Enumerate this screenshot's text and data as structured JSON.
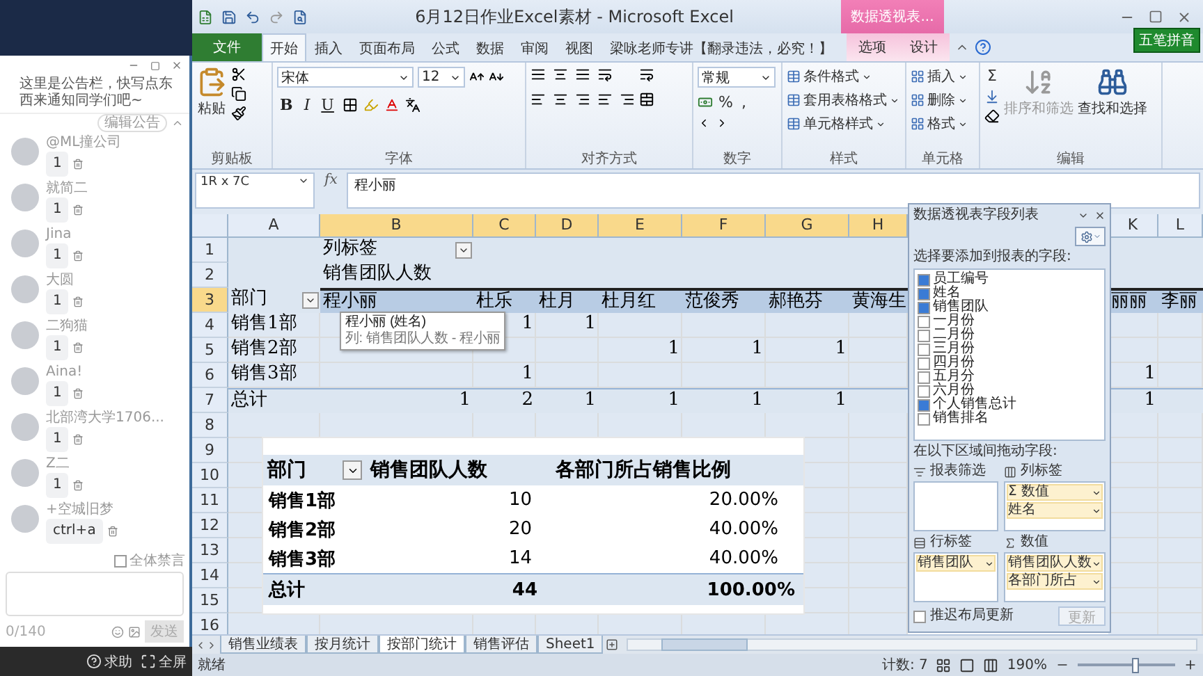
{
  "chat": {
    "announcement": "这里是公告栏，快写点东西来通知同学们吧~",
    "edit_button": "编辑公告",
    "members": [
      {
        "name": "@ML撞公司",
        "message": "1"
      },
      {
        "name": "就简二",
        "message": "1"
      },
      {
        "name": "Jina",
        "message": "1"
      },
      {
        "name": "大圆",
        "message": "1"
      },
      {
        "name": "二狗猫",
        "message": "1"
      },
      {
        "name": "Aina!",
        "message": "1"
      },
      {
        "name": "北部湾大学1706...",
        "message": "1"
      },
      {
        "name": "Z二",
        "message": "1"
      },
      {
        "name": "+空城旧梦",
        "message": "ctrl+a"
      }
    ],
    "mute_all": {
      "label": "全体禁言",
      "checked": false
    },
    "char_count": "0/140",
    "send_button": "发送",
    "help": "求助",
    "fullscreen": "全屏"
  },
  "excel": {
    "title": "6月12日作业Excel素材 - Microsoft Excel",
    "context_group": "数据透视表...",
    "ime_label": "五笔拼音",
    "file_tab": "文件",
    "tabs": [
      {
        "label": "开始",
        "selected": true
      },
      {
        "label": "插入",
        "selected": false
      },
      {
        "label": "页面布局",
        "selected": false
      },
      {
        "label": "公式",
        "selected": false
      },
      {
        "label": "数据",
        "selected": false
      },
      {
        "label": "审阅",
        "selected": false
      },
      {
        "label": "视图",
        "selected": false
      },
      {
        "label": "梁咏老师专讲【翻录违法，必究！】",
        "selected": false
      }
    ],
    "context_tabs": [
      {
        "label": "选项",
        "selected": false
      },
      {
        "label": "设计",
        "selected": false
      }
    ],
    "ribbon": {
      "clipboard": {
        "paste": "粘贴",
        "label": "剪贴板"
      },
      "font": {
        "name": "宋体",
        "size": "12",
        "bold": "B",
        "italic": "I",
        "underline": "U",
        "label": "字体"
      },
      "alignment": {
        "label": "对齐方式"
      },
      "number": {
        "format": "常规",
        "percent": "%",
        "comma": ",",
        "label": "数字"
      },
      "styles": {
        "items": [
          "条件格式",
          "套用表格格式",
          "单元格样式"
        ],
        "label": "样式"
      },
      "cells": {
        "items": [
          "插入",
          "删除",
          "格式"
        ],
        "label": "单元格"
      },
      "editing": {
        "sum": "Σ",
        "sort": "排序和筛选",
        "find": "查找和选择",
        "label": "编辑"
      }
    },
    "formula_bar": {
      "name_box": "1R x 7C",
      "fx": "fx",
      "value": "程小丽"
    },
    "columns": [
      {
        "label": "A",
        "selected": false
      },
      {
        "label": "B",
        "selected": true
      },
      {
        "label": "C",
        "selected": true
      },
      {
        "label": "D",
        "selected": true
      },
      {
        "label": "E",
        "selected": true
      },
      {
        "label": "F",
        "selected": true
      },
      {
        "label": "G",
        "selected": true
      },
      {
        "label": "H",
        "selected": true
      },
      {
        "label": "K",
        "selected": false
      },
      {
        "label": "L",
        "selected": false
      }
    ],
    "rows": [
      {
        "num": "1",
        "kind": "header",
        "selected": false,
        "cells": [
          "",
          {
            "text": "列标签",
            "filter": true
          },
          "",
          "",
          "",
          "",
          "",
          "",
          "",
          ""
        ]
      },
      {
        "num": "2",
        "kind": "header",
        "selected": false,
        "cells": [
          "",
          "销售团队人数",
          "",
          "",
          "",
          "",
          "",
          "",
          "",
          ""
        ]
      },
      {
        "num": "3",
        "kind": "header",
        "selected": true,
        "cells": [
          {
            "text": "部门",
            "filter": true
          },
          "程小丽",
          "杜乐",
          "杜月",
          "杜月红",
          "范俊秀",
          "郝艳芬",
          "黄海生",
          "丽丽",
          "李丽"
        ]
      },
      {
        "num": "4",
        "kind": "item",
        "selected": false,
        "cells": [
          "销售1部",
          "",
          "1",
          "1",
          "",
          "",
          "",
          "",
          "",
          ""
        ]
      },
      {
        "num": "5",
        "kind": "item",
        "selected": false,
        "cells": [
          "销售2部",
          "",
          "",
          "",
          "1",
          "1",
          "1",
          "",
          "",
          ""
        ]
      },
      {
        "num": "6",
        "kind": "item",
        "selected": false,
        "cells": [
          "销售3部",
          "",
          "1",
          "",
          "",
          "",
          "",
          "",
          "1",
          ""
        ]
      },
      {
        "num": "7",
        "kind": "total",
        "selected": false,
        "cells": [
          "总计",
          "1",
          "2",
          "1",
          "1",
          "1",
          "1",
          "",
          "1",
          ""
        ]
      },
      {
        "num": "8",
        "kind": "blank",
        "selected": false
      },
      {
        "num": "9",
        "kind": "blank",
        "selected": false
      },
      {
        "num": "10",
        "kind": "blank",
        "selected": false
      },
      {
        "num": "11",
        "kind": "blank",
        "selected": false
      },
      {
        "num": "12",
        "kind": "blank",
        "selected": false
      },
      {
        "num": "13",
        "kind": "blank",
        "selected": false
      },
      {
        "num": "14",
        "kind": "blank",
        "selected": false
      },
      {
        "num": "15",
        "kind": "blank",
        "selected": false
      },
      {
        "num": "16",
        "kind": "blank",
        "selected": false
      }
    ],
    "tooltip": {
      "title": "程小丽 (姓名)",
      "detail": "列: 销售团队人数 - 程小丽"
    },
    "summary_table": {
      "columns": [
        {
          "label": "部门",
          "filter": true
        },
        {
          "label": "销售团队人数",
          "filter": false
        },
        {
          "label": "各部门所占销售比例",
          "filter": false
        }
      ],
      "rows": [
        {
          "dept": "销售1部",
          "count": "10",
          "share": "20.00%"
        },
        {
          "dept": "销售2部",
          "count": "20",
          "share": "40.00%"
        },
        {
          "dept": "销售3部",
          "count": "14",
          "share": "40.00%"
        }
      ],
      "total": {
        "dept": "总计",
        "count": "44",
        "share": "100.00%"
      }
    },
    "field_list": {
      "title": "数据透视表字段列表",
      "choose_label": "选择要添加到报表的字段:",
      "fields": [
        {
          "label": "员工编号",
          "checked": true
        },
        {
          "label": "姓名",
          "checked": true
        },
        {
          "label": "销售团队",
          "checked": true
        },
        {
          "label": "一月份",
          "checked": false
        },
        {
          "label": "二月份",
          "checked": false
        },
        {
          "label": "三月份",
          "checked": false
        },
        {
          "label": "四月份",
          "checked": false
        },
        {
          "label": "五月分",
          "checked": false
        },
        {
          "label": "六月份",
          "checked": false
        },
        {
          "label": "个人销售总计",
          "checked": true
        },
        {
          "label": "销售排名",
          "checked": false
        }
      ],
      "drag_label": "在以下区域间拖动字段:",
      "areas": [
        {
          "kind": "filter",
          "title": "报表筛选"
        },
        {
          "kind": "columns",
          "title": "列标签",
          "items": [
            "Σ 数值",
            "姓名"
          ]
        },
        {
          "kind": "rows",
          "title": "行标签",
          "items": [
            "销售团队"
          ]
        },
        {
          "kind": "values",
          "title": "数值",
          "items": [
            "销售团队人数",
            "各部门所占"
          ]
        }
      ],
      "defer": {
        "label": "推迟布局更新",
        "checked": false
      },
      "update_button": "更新"
    },
    "sheet_tabs": [
      {
        "label": "销售业绩表",
        "selected": false
      },
      {
        "label": "按月统计",
        "selected": false
      },
      {
        "label": "按部门统计",
        "selected": true
      },
      {
        "label": "销售评估",
        "selected": false
      },
      {
        "label": "Sheet1",
        "selected": false
      }
    ],
    "status_bar": {
      "ready": "就绪",
      "count": "计数: 7",
      "zoom": "190%",
      "zoom_slider": {
        "level": 0.6
      }
    }
  }
}
